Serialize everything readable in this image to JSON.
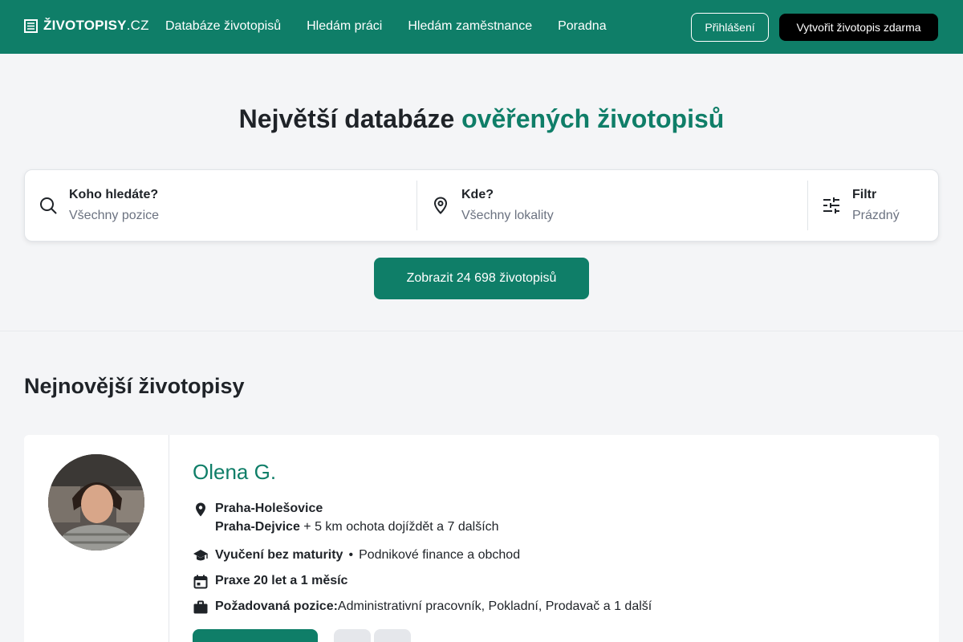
{
  "brand": {
    "bold": "ŽIVOTOPISY",
    "suffix": ".CZ"
  },
  "nav": {
    "items": [
      {
        "label": "Databáze životopisů"
      },
      {
        "label": "Hledám práci"
      },
      {
        "label": "Hledám zaměstnance"
      },
      {
        "label": "Poradna"
      }
    ],
    "login_label": "Přihlášení",
    "create_label": "Vytvořit životopis zdarma"
  },
  "hero": {
    "title_plain": "Největší databáze",
    "title_accent": "ověřených životopisů"
  },
  "search": {
    "who": {
      "label": "Koho hledáte?",
      "placeholder": "Všechny pozice",
      "icon": "search-icon"
    },
    "where": {
      "label": "Kde?",
      "placeholder": "Všechny lokality",
      "icon": "location-pin-icon"
    },
    "filter": {
      "label": "Filtr",
      "placeholder": "Prázdný",
      "icon": "sliders-icon"
    },
    "submit_label": "Zobrazit 24 698 životopisů"
  },
  "section": {
    "title": "Nejnovější životopisy"
  },
  "resume": {
    "name": "Olena G.",
    "location_primary": "Praha-Holešovice",
    "location_secondary": "Praha-Dejvice",
    "location_extra": " + 5 km ochota dojíždět a 7 dalších",
    "education": "Vyučení bez maturity",
    "field": "Podnikové finance a obchod",
    "experience": "Praxe 20 let a 1 měsíc",
    "position_label": "Požadovaná pozice:",
    "position_value": " Administrativní pracovník, Pokladní, Prodavač a 1 další"
  },
  "colors": {
    "brand": "#0f7e68",
    "header": "#0f7e68",
    "dark_button": "#000000"
  }
}
